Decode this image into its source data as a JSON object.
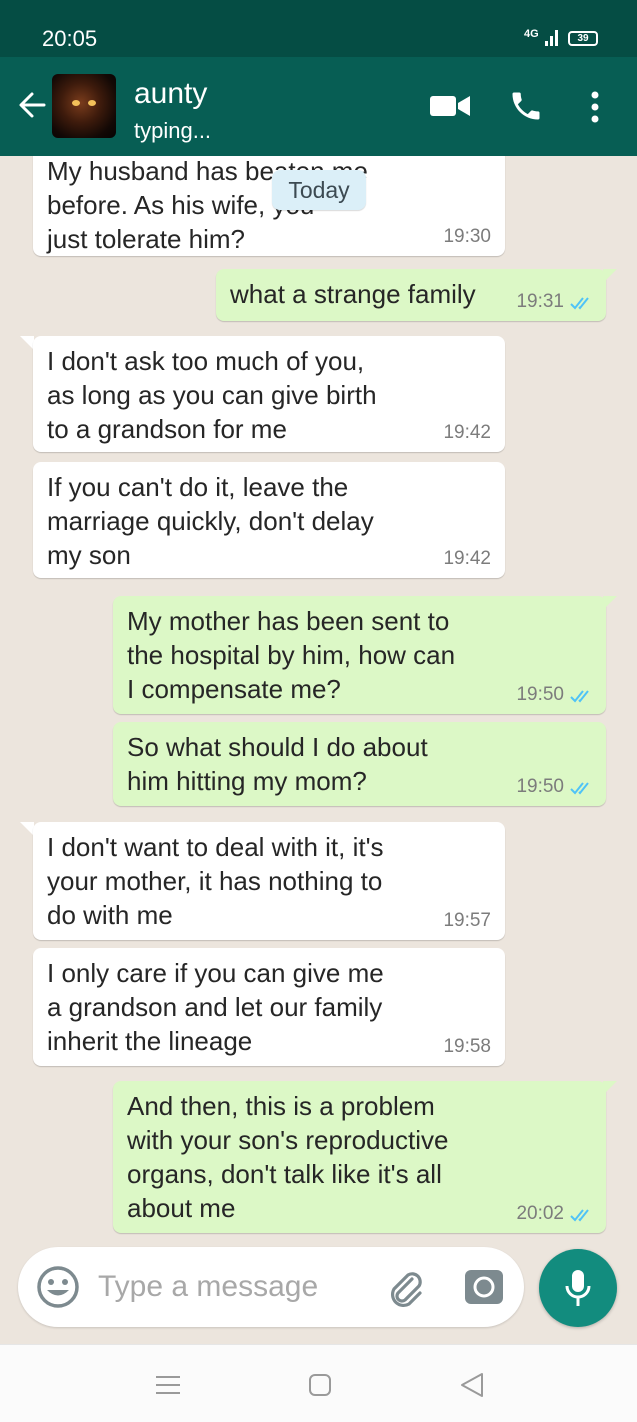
{
  "status_bar": {
    "time": "20:05",
    "network": "4G",
    "battery": "39"
  },
  "header": {
    "contact_name": "aunty",
    "contact_status": "typing..."
  },
  "chat": {
    "date_chip": "Today",
    "messages": [
      {
        "direction": "in",
        "lines": [
          "My husband has beaten me",
          "before. As his wife, you",
          "just tolerate him?"
        ],
        "time": "19:30"
      },
      {
        "direction": "out",
        "lines": [
          "what a strange family"
        ],
        "time": "19:31",
        "read": true
      },
      {
        "direction": "in",
        "lines": [
          "I don't ask too much of you,",
          "as long as you can give birth",
          "to a grandson for me"
        ],
        "time": "19:42"
      },
      {
        "direction": "in",
        "lines": [
          "If you can't do it, leave the",
          "marriage quickly, don't delay",
          "my son"
        ],
        "time": "19:42"
      },
      {
        "direction": "out",
        "lines": [
          "My mother has been sent to",
          "the hospital by him, how can",
          "I compensate me?"
        ],
        "time": "19:50",
        "read": true
      },
      {
        "direction": "out",
        "lines": [
          "So what should I do about",
          "him hitting my mom?"
        ],
        "time": "19:50",
        "read": true
      },
      {
        "direction": "in",
        "lines": [
          "I don't want to deal with it, it's",
          "your mother, it has nothing to",
          "do with me"
        ],
        "time": "19:57"
      },
      {
        "direction": "in",
        "lines": [
          "I only care if you can give me",
          "a grandson and let our family",
          "inherit the lineage"
        ],
        "time": "19:58"
      },
      {
        "direction": "out",
        "lines": [
          "And then, this is a problem",
          "with your son's reproductive",
          "organs, don't talk like it's all",
          "about me"
        ],
        "time": "20:02",
        "read": true
      }
    ]
  },
  "composer": {
    "placeholder": "Type a message"
  },
  "colors": {
    "header": "#075e54",
    "status_bar": "#054d44",
    "outgoing_bubble": "#dcf8c6",
    "incoming_bubble": "#ffffff",
    "tick_read": "#4fc3f7",
    "mic_button": "#128c7e"
  },
  "icons": [
    "back-arrow-icon",
    "video-call-icon",
    "phone-icon",
    "more-vert-icon",
    "emoji-icon",
    "attach-icon",
    "camera-icon",
    "mic-icon"
  ]
}
